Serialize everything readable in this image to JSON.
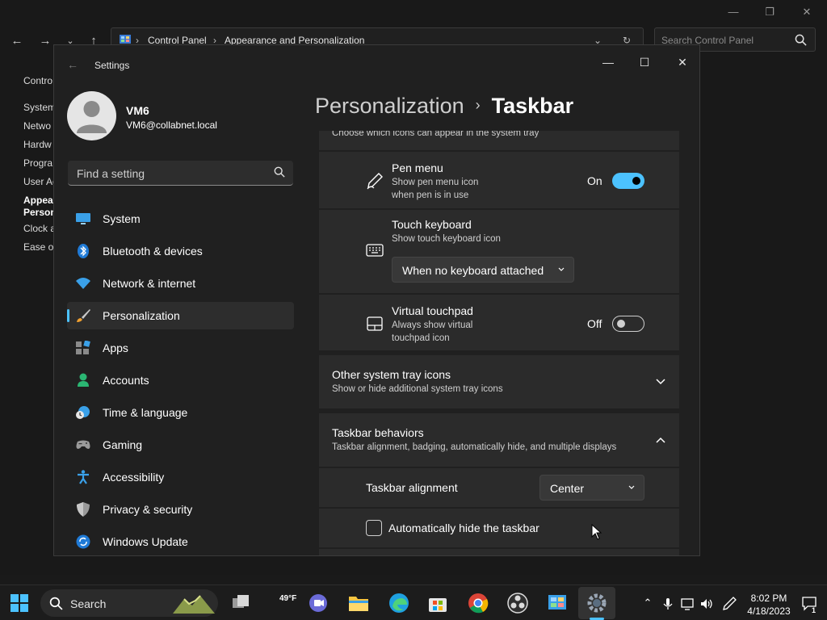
{
  "control_panel": {
    "breadcrumb": [
      "Control Panel",
      "Appearance and Personalization"
    ],
    "search_placeholder": "Search Control Panel",
    "sidebar": [
      "Contro",
      "System",
      "Netwo",
      "Hardw",
      "Progra",
      "User Ac",
      "Appea",
      "Person",
      "Clock a",
      "Ease of"
    ]
  },
  "settings": {
    "title": "Settings",
    "profile": {
      "name": "VM6",
      "email": "VM6@collabnet.local"
    },
    "search_placeholder": "Find a setting",
    "nav": [
      {
        "label": "System",
        "icon": "monitor-icon"
      },
      {
        "label": "Bluetooth & devices",
        "icon": "bluetooth-icon"
      },
      {
        "label": "Network & internet",
        "icon": "wifi-icon"
      },
      {
        "label": "Personalization",
        "icon": "brush-icon",
        "active": true
      },
      {
        "label": "Apps",
        "icon": "apps-icon"
      },
      {
        "label": "Accounts",
        "icon": "person-icon"
      },
      {
        "label": "Time & language",
        "icon": "clock-globe-icon"
      },
      {
        "label": "Gaming",
        "icon": "gamepad-icon"
      },
      {
        "label": "Accessibility",
        "icon": "accessibility-icon"
      },
      {
        "label": "Privacy & security",
        "icon": "shield-icon"
      },
      {
        "label": "Windows Update",
        "icon": "update-icon"
      }
    ],
    "header": {
      "parent": "Personalization",
      "separator": "›",
      "current": "Taskbar"
    },
    "system_tray_subtitle": "Choose which icons can appear in the system tray",
    "pen_menu": {
      "title": "Pen menu",
      "subtitle_1": "Show pen menu icon",
      "subtitle_2": "when pen is in use",
      "state_label": "On",
      "on": true
    },
    "touch_keyboard": {
      "title": "Touch keyboard",
      "subtitle": "Show touch keyboard icon",
      "dropdown_value": "When no keyboard attached"
    },
    "virtual_touchpad": {
      "title": "Virtual touchpad",
      "subtitle_1": "Always show virtual",
      "subtitle_2": "touchpad icon",
      "state_label": "Off",
      "on": false
    },
    "other_tray": {
      "title": "Other system tray icons",
      "subtitle": "Show or hide additional system tray icons"
    },
    "behaviors": {
      "title": "Taskbar behaviors",
      "subtitle": "Taskbar alignment, badging, automatically hide, and multiple displays",
      "alignment_label": "Taskbar alignment",
      "alignment_value": "Center",
      "autohide_label": "Automatically hide the taskbar",
      "autohide_checked": false
    }
  },
  "taskbar": {
    "search_label": "Search",
    "weather_temp": "49°F",
    "time": "8:02 PM",
    "date": "4/18/2023",
    "notification_count": "1"
  },
  "colors": {
    "accent": "#4cc2ff",
    "card": "#2b2b2b",
    "window": "#202020"
  }
}
